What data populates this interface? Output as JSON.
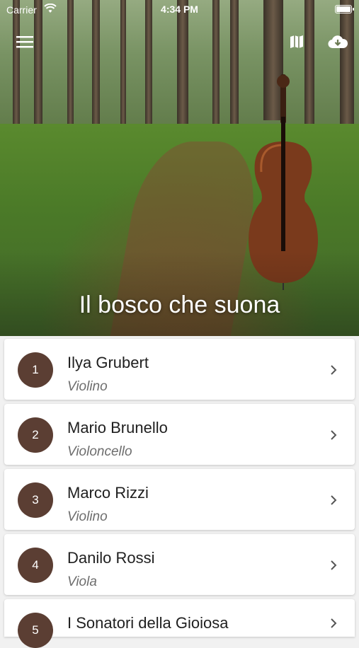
{
  "status_bar": {
    "carrier": "Carrier",
    "time": "4:34 PM"
  },
  "header": {
    "title": "Il bosco che suona"
  },
  "icons": {
    "menu": "hamburger-menu-icon",
    "map": "map-icon",
    "download": "cloud-download-icon"
  },
  "artists": [
    {
      "number": "1",
      "name": "Ilya Grubert",
      "instrument": "Violino"
    },
    {
      "number": "2",
      "name": "Mario Brunello",
      "instrument": "Violoncello"
    },
    {
      "number": "3",
      "name": "Marco Rizzi",
      "instrument": "Violino"
    },
    {
      "number": "4",
      "name": "Danilo Rossi",
      "instrument": "Viola"
    },
    {
      "number": "5",
      "name": "I Sonatori della Gioiosa",
      "instrument": ""
    }
  ],
  "colors": {
    "badge": "#5b3e33",
    "card": "#ffffff",
    "background": "#f1f1f1"
  }
}
